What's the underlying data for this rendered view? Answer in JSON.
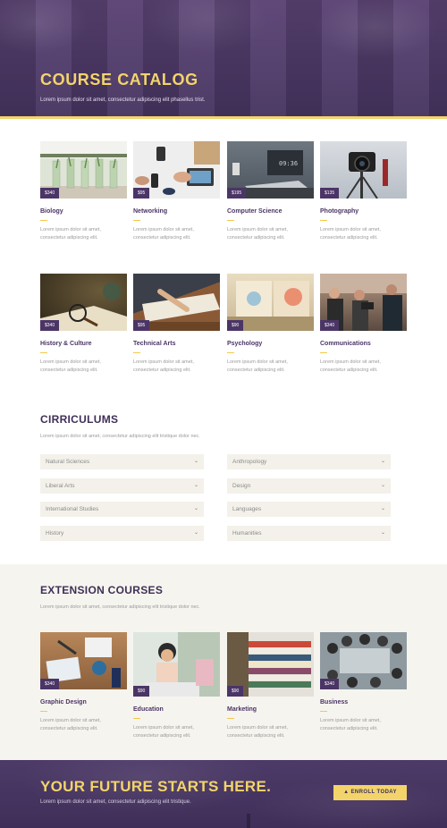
{
  "hero": {
    "title": "COURSE CATALOG",
    "subtitle": "Lorem ipsum dolor sit amet, consectetur adipiscing elit phasellus trist."
  },
  "courses": [
    {
      "title": "Biology",
      "price": "$340",
      "desc_line1": "Lorem ipsum dolor sit amet,",
      "desc_line2": "consectetur adipiscing elit."
    },
    {
      "title": "Networking",
      "price": "$95",
      "desc_line1": "Lorem ipsum dolor sit amet,",
      "desc_line2": "consectetur adipiscing elit."
    },
    {
      "title": "Computer Science",
      "price": "$195",
      "desc_line1": "Lorem ipsum dolor sit amet,",
      "desc_line2": "consectetur adipiscing elit."
    },
    {
      "title": "Photography",
      "price": "$135",
      "desc_line1": "Lorem ipsum dolor sit amet,",
      "desc_line2": "consectetur adipiscing elit."
    },
    {
      "title": "History & Culture",
      "price": "$340",
      "desc_line1": "Lorem ipsum dolor sit amet,",
      "desc_line2": "consectetur adipiscing elit."
    },
    {
      "title": "Technical Arts",
      "price": "$95",
      "desc_line1": "Lorem ipsum dolor sit amet,",
      "desc_line2": "consectetur adipiscing elit."
    },
    {
      "title": "Psychology",
      "price": "$90",
      "desc_line1": "Lorem ipsum dolor sit amet,",
      "desc_line2": "consectetur adipiscing elit."
    },
    {
      "title": "Communications",
      "price": "$340",
      "desc_line1": "Lorem ipsum dolor sit amet,",
      "desc_line2": "consectetur adipiscing elit."
    }
  ],
  "curriculums": {
    "title": "CIRRICULUMS",
    "subtitle": "Lorem ipsum dolor sit amet, consectetur adipiscing elit tristique dolor nec.",
    "left": [
      "Natural Sciences",
      "Liberal Arts",
      "International Studies",
      "History"
    ],
    "right": [
      "Anthropology",
      "Design",
      "Languages",
      "Humanities"
    ]
  },
  "extension": {
    "title": "EXTENSION COURSES",
    "subtitle": "Lorem ipsum dolor sit amet, consectetur adipiscing elit tristique dolor nec.",
    "courses": [
      {
        "title": "Graphic Design",
        "price": "$340",
        "desc_line1": "Lorem ipsum dolor sit amet,",
        "desc_line2": "consectetur adipiscing elit."
      },
      {
        "title": "Education",
        "price": "$90",
        "desc_line1": "Lorem ipsum dolor sit amet,",
        "desc_line2": "consectetur adipiscing elit."
      },
      {
        "title": "Marketing",
        "price": "$90",
        "desc_line1": "Lorem ipsum dolor sit amet,",
        "desc_line2": "consectetur adipiscing elit."
      },
      {
        "title": "Business",
        "price": "$340",
        "desc_line1": "Lorem ipsum dolor sit amet,",
        "desc_line2": "consectetur adipiscing elit."
      }
    ]
  },
  "cta": {
    "title": "YOUR FUTURE STARTS HERE.",
    "subtitle": "Lorem ipsum dolor sit amet, consectetur adipiscing elit tristique.",
    "button": "ENROLL TODAY",
    "button_icon": "graduation-cap-icon"
  },
  "colors": {
    "purple": "#4b3566",
    "gold": "#f3d46b",
    "cream": "#f4f1ea"
  }
}
